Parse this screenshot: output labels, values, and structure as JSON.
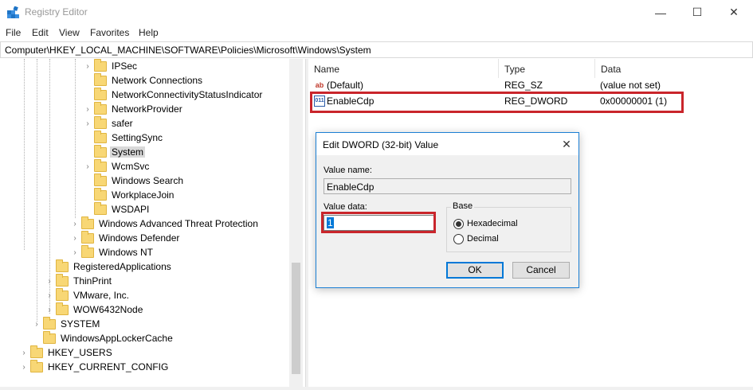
{
  "window": {
    "title": "Registry Editor",
    "minimize_glyph": "—",
    "maximize_glyph": "☐",
    "close_glyph": "✕"
  },
  "menu": [
    "File",
    "Edit",
    "View",
    "Favorites",
    "Help"
  ],
  "address": "Computer\\HKEY_LOCAL_MACHINE\\SOFTWARE\\Policies\\Microsoft\\Windows\\System",
  "tree": {
    "items": [
      {
        "label": "IPSec",
        "expandable": true
      },
      {
        "label": "Network Connections",
        "expandable": false
      },
      {
        "label": "NetworkConnectivityStatusIndicator",
        "expandable": false
      },
      {
        "label": "NetworkProvider",
        "expandable": true
      },
      {
        "label": "safer",
        "expandable": true
      },
      {
        "label": "SettingSync",
        "expandable": false
      },
      {
        "label": "System",
        "expandable": false,
        "selected": true
      },
      {
        "label": "WcmSvc",
        "expandable": true
      },
      {
        "label": "Windows Search",
        "expandable": false
      },
      {
        "label": "WorkplaceJoin",
        "expandable": false
      },
      {
        "label": "WSDAPI",
        "expandable": false
      },
      {
        "label": "Windows Advanced Threat Protection",
        "expandable": true
      },
      {
        "label": "Windows Defender",
        "expandable": true
      },
      {
        "label": "Windows NT",
        "expandable": true
      },
      {
        "label": "RegisteredApplications",
        "expandable": false
      },
      {
        "label": "ThinPrint",
        "expandable": true
      },
      {
        "label": "VMware, Inc.",
        "expandable": true
      },
      {
        "label": "WOW6432Node",
        "expandable": true
      },
      {
        "label": "SYSTEM",
        "expandable": true
      },
      {
        "label": "WindowsAppLockerCache",
        "expandable": false
      },
      {
        "label": "HKEY_USERS",
        "expandable": true
      },
      {
        "label": "HKEY_CURRENT_CONFIG",
        "expandable": true
      }
    ]
  },
  "list": {
    "columns": [
      "Name",
      "Type",
      "Data"
    ],
    "rows": [
      {
        "icon": "ab",
        "name": "(Default)",
        "type": "REG_SZ",
        "data": "(value not set)"
      },
      {
        "icon": "011",
        "name": "EnableCdp",
        "type": "REG_DWORD",
        "data": "0x00000001 (1)"
      }
    ]
  },
  "dialog": {
    "title": "Edit DWORD (32-bit) Value",
    "close_glyph": "✕",
    "value_name_label": "Value name:",
    "value_name": "EnableCdp",
    "value_data_label": "Value data:",
    "value_data": "1",
    "base_label": "Base",
    "options": [
      {
        "label": "Hexadecimal",
        "checked": true
      },
      {
        "label": "Decimal",
        "checked": false
      }
    ],
    "ok_label": "OK",
    "cancel_label": "Cancel"
  },
  "colors": {
    "highlight": "#c9252b",
    "dialog_border": "#1b7fd4",
    "selection": "#0078d7"
  }
}
